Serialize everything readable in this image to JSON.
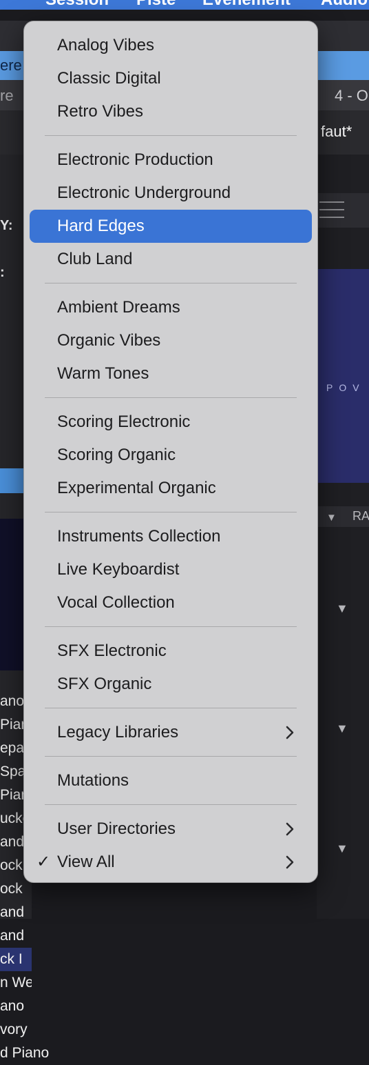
{
  "background": {
    "menubar": [
      "Session",
      "Piste",
      "Événement",
      "Audio"
    ],
    "blue_strip_text": "ere",
    "row3_left": "re",
    "row3_right": "4 - O",
    "row4_right": "faut*",
    "left_labels": [
      "Y:",
      ":"
    ],
    "left_list": [
      "ano",
      "Pian",
      "epa",
      "Spa",
      "Pian",
      "ucke",
      "and",
      "ock",
      "ock",
      "and",
      "and",
      "ck I",
      "n We",
      "ano",
      "vory",
      "d Piano"
    ],
    "right_art_text": "POV",
    "right_header_label": "RA"
  },
  "menu": {
    "groups": [
      [
        {
          "label": "Analog Vibes"
        },
        {
          "label": "Classic Digital"
        },
        {
          "label": "Retro Vibes"
        }
      ],
      [
        {
          "label": "Electronic Production"
        },
        {
          "label": "Electronic Underground"
        },
        {
          "label": "Hard Edges",
          "selected": true
        },
        {
          "label": "Club Land"
        }
      ],
      [
        {
          "label": "Ambient Dreams"
        },
        {
          "label": "Organic Vibes"
        },
        {
          "label": "Warm Tones"
        }
      ],
      [
        {
          "label": "Scoring Electronic"
        },
        {
          "label": "Scoring Organic"
        },
        {
          "label": "Experimental Organic"
        }
      ],
      [
        {
          "label": "Instruments Collection"
        },
        {
          "label": "Live Keyboardist"
        },
        {
          "label": "Vocal Collection"
        }
      ],
      [
        {
          "label": "SFX Electronic"
        },
        {
          "label": "SFX Organic"
        }
      ],
      [
        {
          "label": "Legacy Libraries",
          "submenu": true
        }
      ],
      [
        {
          "label": "Mutations"
        }
      ],
      [
        {
          "label": "User Directories",
          "submenu": true
        },
        {
          "label": "View All",
          "checked": true,
          "submenu": true
        }
      ]
    ],
    "check_glyph": "✓",
    "chevron_icon": "chevron-right-icon",
    "selection_color": "#3a74d5"
  }
}
